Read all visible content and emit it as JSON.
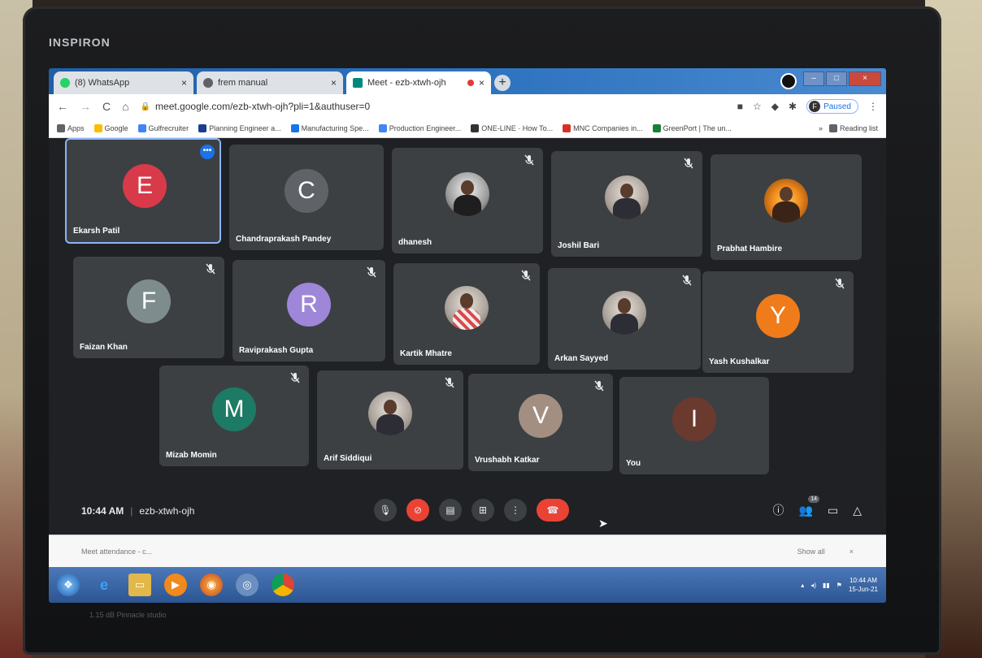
{
  "device": {
    "brand": "INSPIRON",
    "sticker_text": "1.15 dB Pinnacle studio"
  },
  "browser": {
    "tabs": [
      {
        "title": "(8) WhatsApp",
        "favicon_color": "#25d366",
        "active": false
      },
      {
        "title": "frem manual",
        "favicon_color": "#5f6368",
        "active": false
      },
      {
        "title": "Meet - ezb-xtwh-ojh",
        "favicon_color": "#00897b",
        "active": true
      }
    ],
    "new_tab_label": "+",
    "url": "meet.google.com/ezb-xtwh-ojh?pli=1&authuser=0",
    "profile_status": "Paused",
    "profile_initial": "F",
    "bookmarks": [
      {
        "label": "Apps",
        "color": "#5f6368"
      },
      {
        "label": "Google",
        "color": "#fbbc04"
      },
      {
        "label": "Gulfrecruiter",
        "color": "#4285f4"
      },
      {
        "label": "Planning Engineer a...",
        "color": "#1a3d8f"
      },
      {
        "label": "Manufacturing Spe...",
        "color": "#1a73e8"
      },
      {
        "label": "Production Engineer...",
        "color": "#4285f4"
      },
      {
        "label": "ONE-LINE · How To...",
        "color": "#333333"
      },
      {
        "label": "MNC Companies in...",
        "color": "#d93025"
      },
      {
        "label": "GreenPort | The un...",
        "color": "#188038"
      }
    ],
    "reading_list_label": "Reading list",
    "chevron_label": "»"
  },
  "meet": {
    "participants": [
      {
        "name": "Ekarsh Patil",
        "initial": "E",
        "avatar_color": "#d93a4a",
        "type": "initial",
        "muted": false,
        "pinned": true
      },
      {
        "name": "Chandraprakash Pandey",
        "initial": "C",
        "avatar_color": "#5f6368",
        "type": "initial",
        "muted": false
      },
      {
        "name": "dhanesh",
        "type": "photo",
        "photo_style": "bw",
        "muted": true
      },
      {
        "name": "Joshil Bari",
        "type": "photo",
        "photo_style": "default",
        "muted": true
      },
      {
        "name": "Prabhat Hambire",
        "type": "photo",
        "photo_style": "fire",
        "muted": false
      },
      {
        "name": "Faizan Khan",
        "initial": "F",
        "avatar_color": "#7e8c8d",
        "type": "initial",
        "muted": true
      },
      {
        "name": "Raviprakash Gupta",
        "initial": "R",
        "avatar_color": "#9e86d9",
        "type": "initial",
        "muted": true
      },
      {
        "name": "Kartik Mhatre",
        "type": "photo",
        "photo_style": "check",
        "muted": true
      },
      {
        "name": "Arkan Sayyed",
        "type": "photo",
        "photo_style": "default",
        "muted": true
      },
      {
        "name": "Yash Kushalkar",
        "initial": "Y",
        "avatar_color": "#ef7b1a",
        "type": "initial",
        "muted": true
      },
      {
        "name": "Mizab Momin",
        "initial": "M",
        "avatar_color": "#1d7a64",
        "type": "initial",
        "muted": true
      },
      {
        "name": "Arif Siddiqui",
        "type": "photo",
        "photo_style": "default",
        "muted": true
      },
      {
        "name": "Vrushabh Katkar",
        "initial": "V",
        "avatar_color": "#a38f82",
        "type": "initial",
        "muted": true
      },
      {
        "name": "You",
        "initial": "I",
        "avatar_color": "#6b3a2e",
        "type": "initial",
        "muted": false
      }
    ],
    "time": "10:44 AM",
    "meeting_code": "ezb-xtwh-ojh",
    "people_count": "14"
  },
  "downloads": {
    "item": "Meet attendance - c...",
    "show_all": "Show all",
    "close": "×"
  },
  "taskbar": {
    "clock_time": "10:44 AM",
    "clock_date": "15-Jun-21"
  }
}
